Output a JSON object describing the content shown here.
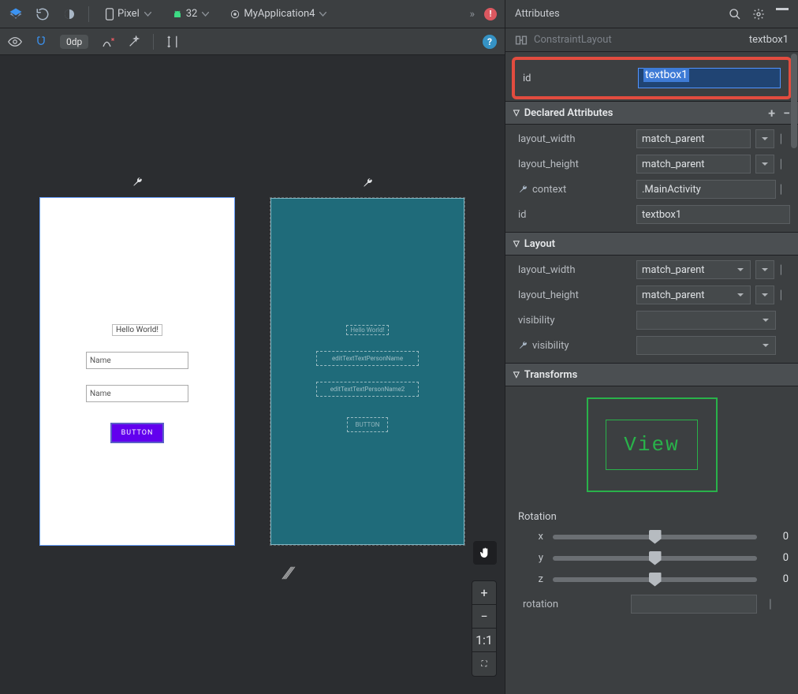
{
  "toolbar": {
    "device": "Pixel",
    "api": "32",
    "app": "MyApplication4",
    "overflow": "»",
    "warning": "!"
  },
  "subbar": {
    "dp": "0dp",
    "help": "?"
  },
  "design": {
    "hello": "Hello World!",
    "field1": "Name",
    "field2": "Name",
    "button": "BUTTON"
  },
  "blueprint": {
    "hello": "Hello World!",
    "field1": "editTextTextPersonName",
    "field2": "editTextTextPersonName2",
    "button": "BUTTON"
  },
  "zoom": {
    "plus": "+",
    "minus": "−",
    "fit": "1:1",
    "full": "⛶"
  },
  "attributes": {
    "title": "Attributes",
    "crumb_type": "ConstraintLayout",
    "crumb_sel": "textbox1",
    "id_label": "id",
    "id_value": "textbox1",
    "sections": {
      "declared": "Declared Attributes",
      "layout": "Layout",
      "transforms": "Transforms"
    },
    "declared": {
      "layout_width": {
        "label": "layout_width",
        "value": "match_parent"
      },
      "layout_height": {
        "label": "layout_height",
        "value": "match_parent"
      },
      "context": {
        "label": "context",
        "value": ".MainActivity"
      },
      "id": {
        "label": "id",
        "value": "textbox1"
      }
    },
    "layout": {
      "layout_width": {
        "label": "layout_width",
        "value": "match_parent"
      },
      "layout_height": {
        "label": "layout_height",
        "value": "match_parent"
      },
      "visibility": {
        "label": "visibility",
        "value": ""
      },
      "tool_visibility": {
        "label": "visibility",
        "value": ""
      }
    },
    "transforms": {
      "view_label": "View",
      "rotation_label": "Rotation",
      "x": {
        "label": "x",
        "value": "0"
      },
      "y": {
        "label": "y",
        "value": "0"
      },
      "z": {
        "label": "z",
        "value": "0"
      },
      "rotation": {
        "label": "rotation",
        "value": ""
      }
    }
  }
}
